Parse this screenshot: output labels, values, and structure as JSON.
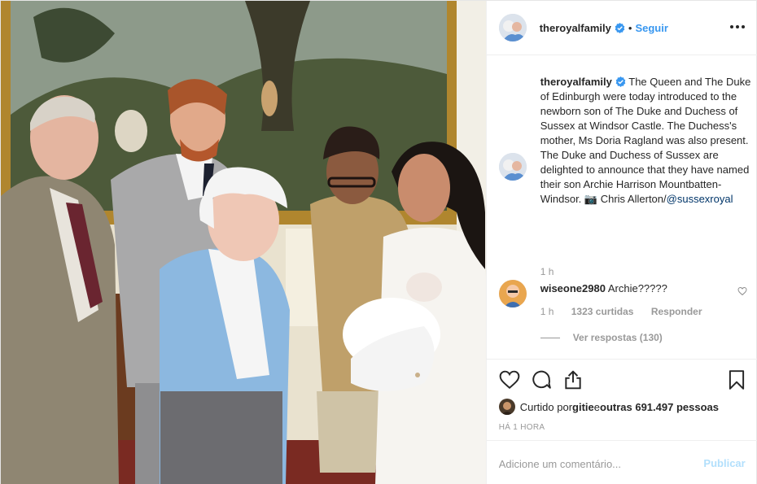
{
  "header": {
    "username": "theroyalfamily",
    "separator": "•",
    "follow_label": "Seguir",
    "more_icon": "more-dots-icon"
  },
  "caption": {
    "username": "theroyalfamily",
    "text": "The Queen and The Duke of Edinburgh were today introduced to the newborn son of The Duke and Duchess of Sussex at Windsor Castle. The Duchess's mother, Ms Doria Ragland was also present. The Duke and Duchess of Sussex are delighted to announce that they have named their son Archie Harrison Mountbatten-Windsor. ",
    "camera_emoji": "📷",
    "credit": " Chris Allerton/",
    "mention": "@sussexroyal",
    "time": "1 h"
  },
  "comment": {
    "username": "wiseone2980",
    "text": "Archie?????",
    "time": "1 h",
    "likes": "1323 curtidas",
    "reply_label": "Responder",
    "view_replies": "Ver respostas (130)"
  },
  "actions": {
    "like_icon": "heart-icon",
    "comment_icon": "comment-icon",
    "share_icon": "share-icon",
    "save_icon": "bookmark-icon"
  },
  "likes": {
    "prefix": "Curtido por ",
    "user": "gitie",
    "middle": " e ",
    "others": "outras 691.497 pessoas"
  },
  "timestamp": "HÁ 1 HORA",
  "add_comment": {
    "placeholder": "Adicione um comentário...",
    "publish_label": "Publicar"
  },
  "colors": {
    "link": "#3897f0",
    "publish_disabled": "#b2dffc",
    "muted": "#999999"
  }
}
